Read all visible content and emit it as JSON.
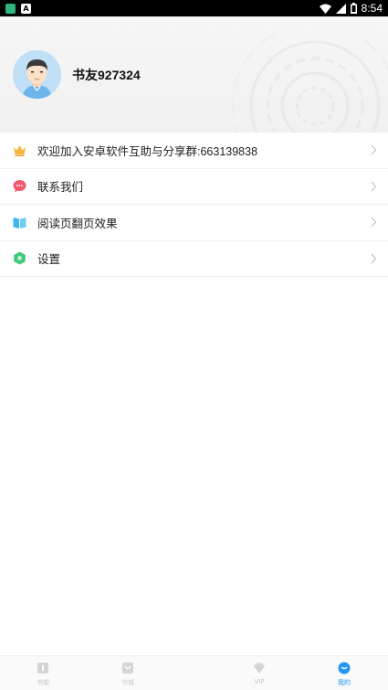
{
  "status_bar": {
    "time": "8:54",
    "left_icons": [
      "app-notification-icon",
      "a-notification-icon"
    ],
    "right_icons": [
      "wifi-icon",
      "signal-icon",
      "battery-icon"
    ]
  },
  "profile": {
    "username": "书友927324",
    "avatar": "avatar-icon"
  },
  "menu": {
    "items": [
      {
        "label": "欢迎加入安卓软件互助与分享群:663139838",
        "icon": "crown-icon",
        "icon_color": "#f5b63c"
      },
      {
        "label": "联系我们",
        "icon": "chat-bubble-icon",
        "icon_color": "#f25a6b"
      },
      {
        "label": "阅读页翻页效果",
        "icon": "book-icon",
        "icon_color": "#3fb7f0"
      },
      {
        "label": "设置",
        "icon": "settings-hex-icon",
        "icon_color": "#3fc97a"
      }
    ]
  },
  "tabs": [
    {
      "label": "书架",
      "icon": "bookshelf-icon",
      "active": false
    },
    {
      "label": "书城",
      "icon": "bookstore-icon",
      "active": false
    },
    {
      "label": "VIP",
      "icon": "diamond-icon",
      "active": false
    },
    {
      "label": "我的",
      "icon": "profile-icon",
      "active": true
    }
  ],
  "colors": {
    "accent": "#2196f3",
    "inactive_tab": "#c8c8c8",
    "header_bg": "#f3f3f3"
  }
}
